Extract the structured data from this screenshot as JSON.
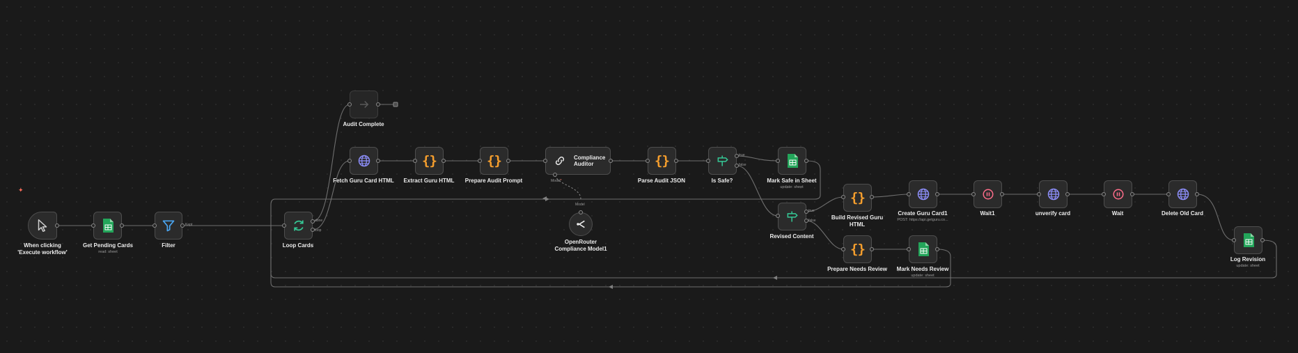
{
  "nodes": {
    "trigger": {
      "title": "When clicking 'Execute workflow'",
      "subtitle": ""
    },
    "get_pending": {
      "title": "Get Pending Cards",
      "subtitle": "read: sheet"
    },
    "filter": {
      "title": "Filter",
      "subtitle": ""
    },
    "loop": {
      "title": "Loop Cards",
      "subtitle": ""
    },
    "audit_done": {
      "title": "Audit Complete",
      "subtitle": ""
    },
    "fetch": {
      "title": "Fetch Guru Card HTML",
      "subtitle": ""
    },
    "extract": {
      "title": "Extract Guru HTML",
      "subtitle": ""
    },
    "prepare": {
      "title": "Prepare Audit Prompt",
      "subtitle": ""
    },
    "auditor": {
      "title": "Compliance Auditor",
      "subtitle": ""
    },
    "openrouter": {
      "title": "OpenRouter Compliance Model1",
      "subtitle": ""
    },
    "parse": {
      "title": "Parse Audit JSON",
      "subtitle": ""
    },
    "is_safe": {
      "title": "Is Safe?",
      "subtitle": ""
    },
    "mark_safe": {
      "title": "Mark Safe in Sheet",
      "subtitle": "update: sheet"
    },
    "revised": {
      "title": "Revised Content",
      "subtitle": ""
    },
    "build": {
      "title": "Build Revised Guru HTML",
      "subtitle": ""
    },
    "create": {
      "title": "Create Guru Card1",
      "subtitle": "POST: https://api.getguru.co..."
    },
    "wait1": {
      "title": "Wait1",
      "subtitle": ""
    },
    "unverify": {
      "title": "unverify card",
      "subtitle": ""
    },
    "wait": {
      "title": "Wait",
      "subtitle": ""
    },
    "delete": {
      "title": "Delete Old Card",
      "subtitle": ""
    },
    "log": {
      "title": "Log Revision",
      "subtitle": "update: sheet"
    },
    "prep_review": {
      "title": "Prepare Needs Review",
      "subtitle": ""
    },
    "mark_review": {
      "title": "Mark Needs Review",
      "subtitle": "update: sheet"
    }
  },
  "branch_labels": {
    "keep": "Kept",
    "loop_done": "done",
    "loop_loop": "loop",
    "safe_true": "true",
    "safe_false": "false",
    "rev_true": "true",
    "rev_false": "false",
    "model": "Model",
    "model_required": "*",
    "model_sub": "Model"
  },
  "colors": {
    "sheets": "#23a55a",
    "http": "#8b8cf6",
    "code": "#f59e2d",
    "switch": "#35c996",
    "filter": "#4aa6f2",
    "wait": "#ff6d8a",
    "trigger_star": "#ff6d5a"
  }
}
